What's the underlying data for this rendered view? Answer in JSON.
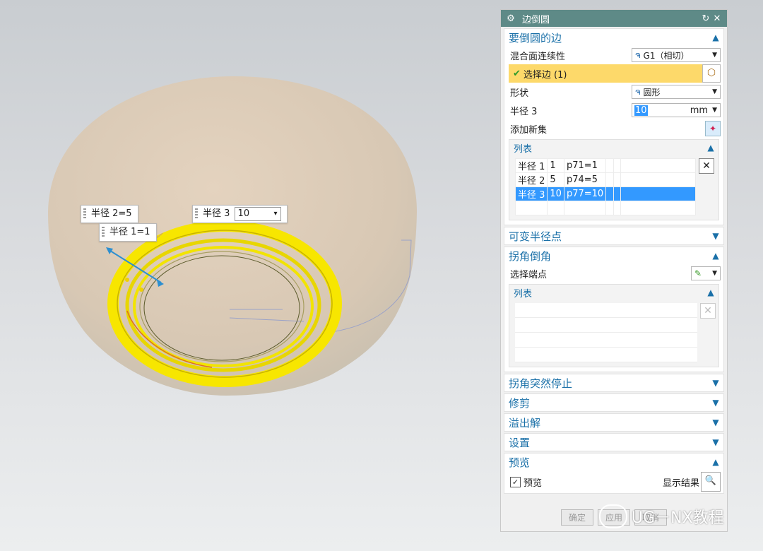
{
  "viewport": {
    "tags": [
      {
        "label": "半径 2=5"
      },
      {
        "label": "半径 1=1"
      },
      {
        "label": "半径 3",
        "value": "10"
      }
    ]
  },
  "dialog": {
    "title": "边倒圆",
    "sections": {
      "edges": {
        "header": "要倒圆的边",
        "continuity_label": "混合面连续性",
        "continuity_value": "G1（相切）",
        "select_edge": "选择边 (1)",
        "shape_label": "形状",
        "shape_value": "圆形",
        "radius_label": "半径 3",
        "radius_value": "10",
        "radius_unit": "mm",
        "add_set_label": "添加新集",
        "list_header": "列表",
        "list_rows": [
          {
            "name": "半径 1",
            "idx": "1",
            "expr": "p71=1"
          },
          {
            "name": "半径 2",
            "idx": "5",
            "expr": "p74=5"
          },
          {
            "name": "半径 3",
            "idx": "10",
            "expr": "p77=10"
          }
        ]
      },
      "variable": {
        "header": "可变半径点"
      },
      "corner": {
        "header": "拐角倒角",
        "select_end_label": "选择端点",
        "list_header": "列表"
      },
      "corner_stop": {
        "header": "拐角突然停止"
      },
      "trim": {
        "header": "修剪"
      },
      "overflow": {
        "header": "溢出解"
      },
      "settings": {
        "header": "设置"
      },
      "preview": {
        "header": "预览",
        "preview_check": "预览",
        "show_result": "显示结果"
      }
    },
    "buttons": {
      "ok": "确定",
      "apply": "应用",
      "cancel": "取消"
    }
  },
  "watermark": {
    "text": "UG－NX教程"
  },
  "colors": {
    "titlebar": "#5e8a87",
    "accent": "#1a70a8",
    "selected_row": "#3399ff",
    "highlight": "#fdd96a",
    "fillet": "#f7e600"
  }
}
